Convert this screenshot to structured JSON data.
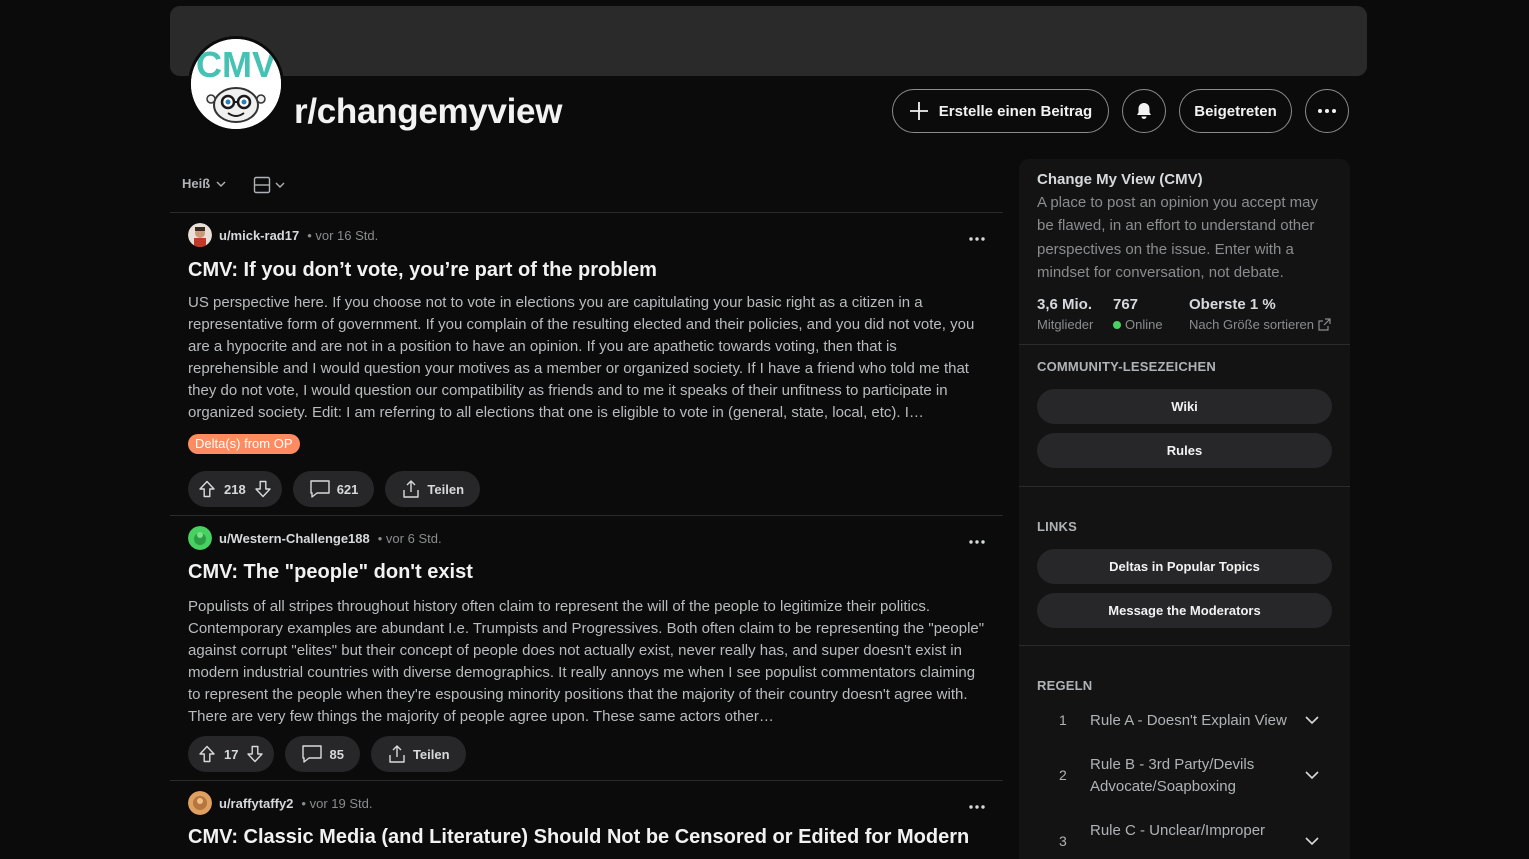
{
  "header": {
    "subreddit": "r/changemyview",
    "create_post_label": "Erstelle einen Beitrag",
    "joined_label": "Beigetreten",
    "logo_text": "CMV"
  },
  "feed": {
    "sort_label": "Heiß"
  },
  "posts": [
    {
      "author": "u/mick-rad17",
      "time": "• vor 16 Std.",
      "title": "CMV: If you don’t vote, you’re part of the problem",
      "body": "US perspective here. If you choose not to vote in elections you are capitulating your basic right as a citizen in a representative form of government. If you complain of the resulting elected and their policies, and you did not vote, you are a hypocrite and are not in a position to have an opinion. If you are apathetic towards voting, then that is reprehensible and I would question your motives as a member or organized society. If I have a friend who told me that they do not vote, I would question our compatibility as friends and to me it speaks of their unfitness to participate in organized society. Edit: I am referring to all elections that one is eligible to vote in (general, state, local, etc). I…",
      "flair": "Delta(s) from OP",
      "votes": "218",
      "comments": "621",
      "share_label": "Teilen"
    },
    {
      "author": "u/Western-Challenge188",
      "time": "• vor 6 Std.",
      "title": "CMV: The \"people\" don't exist",
      "body": "Populists of all stripes throughout history often claim to represent the will of the people to legitimize their politics. Contemporary examples are abundant I.e. Trumpists and Progressives. Both often claim to be representing the \"people\" against corrupt \"elites\" but their concept of people does not actually exist, never really has, and super doesn't exist in modern industrial countries with diverse demographics. It really annoys me when I see populist commentators claiming to represent the people when they're espousing minority positions that the majority of their country doesn't agree with. There are very few things the majority of people agree upon. These same actors other…",
      "votes": "17",
      "comments": "85",
      "share_label": "Teilen"
    },
    {
      "author": "u/raffytaffy2",
      "time": "• vor 19 Std.",
      "title": "CMV: Classic Media (and Literature) Should Not be Censored or Edited for Modern"
    }
  ],
  "sidebar": {
    "title": "Change My View (CMV)",
    "description": "A place to post an opinion you accept may be flawed, in an effort to understand other perspectives on the issue. Enter with a mindset for conversation, not debate.",
    "stats": [
      {
        "value": "3,6 Mio.",
        "label": "Mitglieder"
      },
      {
        "value": "767",
        "label": "Online"
      },
      {
        "value": "Oberste 1 %",
        "label": "Nach Größe sortieren"
      }
    ],
    "bookmarks_heading": "COMMUNITY-LESEZEICHEN",
    "bookmarks": [
      "Wiki",
      "Rules"
    ],
    "links_heading": "LINKS",
    "links": [
      "Deltas in Popular Topics",
      "Message the Moderators"
    ],
    "rules_heading": "REGELN",
    "rules": [
      {
        "num": "1",
        "text": "Rule A - Doesn't Explain View"
      },
      {
        "num": "2",
        "text": "Rule B - 3rd Party/Devils Advocate/Soapboxing"
      },
      {
        "num": "3",
        "text": "Rule C - Unclear/Improper"
      }
    ]
  },
  "colors": {
    "background": "#0b0b0b",
    "card": "#131314",
    "pill": "#272729",
    "flair": "#ff8b60",
    "online": "#46d160",
    "logo_teal": "#46c2b5"
  }
}
